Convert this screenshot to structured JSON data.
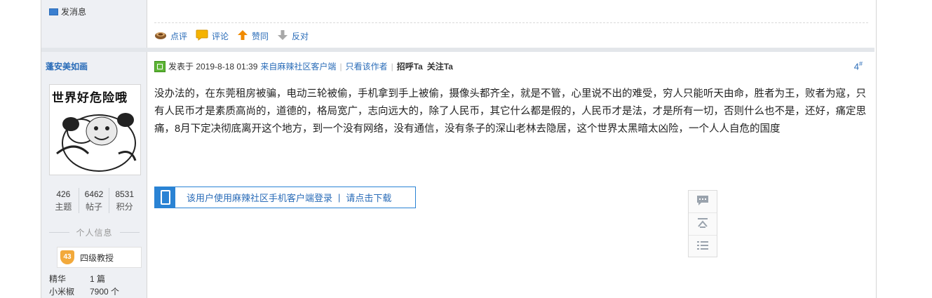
{
  "top": {
    "send_message": "发消息"
  },
  "actions": [
    {
      "label": "点评",
      "icon": "coffee-cup-icon"
    },
    {
      "label": "评论",
      "icon": "speech-bubble-icon"
    },
    {
      "label": "赞同",
      "icon": "arrow-up-icon"
    },
    {
      "label": "反对",
      "icon": "arrow-down-icon"
    }
  ],
  "user": {
    "name": "蓬安美如画",
    "avatar_caption": "世界好危险哦",
    "stats": [
      {
        "value": "426",
        "label": "主题"
      },
      {
        "value": "6462",
        "label": "帖子"
      },
      {
        "value": "8531",
        "label": "积分"
      }
    ],
    "section_title": "个人信息",
    "rank_level": "43",
    "rank_title": "四级教授",
    "fields": [
      {
        "key": "精华",
        "value": "1 篇"
      },
      {
        "key": "小米椒",
        "value": "7900 个"
      }
    ]
  },
  "post": {
    "posted_at": "发表于 2019-8-18 01:39",
    "source": "来自麻辣社区客户端",
    "only_author": "只看该作者",
    "greet": "招呼Ta",
    "follow": "关注Ta",
    "floor": "4",
    "floor_mark": "#",
    "body": "没办法的，在东莞租房被骗，电动三轮被偷，手机拿到手上被偷，摄像头都齐全，就是不管，心里说不出的难受，穷人只能听天由命，胜者为王，败者为寇，只有人民币才是素质高尚的，道德的，格局宽广，志向远大的，除了人民币，其它什么都是假的，人民币才是法，才是所有一切，否则什么也不是，还好，痛定思痛，8月下定决彻底离开这个地方，到一个没有网络，没有通信，没有条子的深山老林去隐居，这个世界太黑暗太凶险，一个人人自危的国度",
    "app_login": "该用户使用麻辣社区手机客户端登录",
    "app_sep": "|",
    "app_download": "请点击下载"
  },
  "colors": {
    "link": "#2a6cb8",
    "sidebar_bg": "#eef0f4",
    "accent": "#2a83d4"
  }
}
